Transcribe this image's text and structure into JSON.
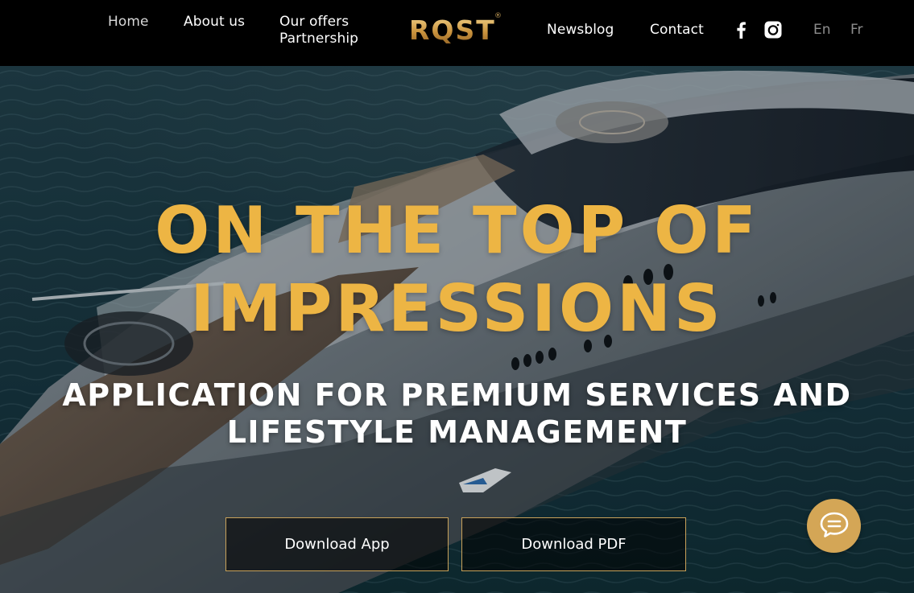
{
  "header": {
    "nav_left": {
      "home": "Home",
      "about": "About us",
      "offers": "Our offers",
      "partnership": "Partnership"
    },
    "logo": "RQST",
    "logo_mark": "®",
    "nav_right": {
      "newsblog": "Newsblog",
      "contact": "Contact"
    },
    "social_icons": [
      "facebook-icon",
      "instagram-icon"
    ],
    "languages": [
      "En",
      "Fr"
    ]
  },
  "hero": {
    "headline_line1": "ON THE TOP OF",
    "headline_line2": "IMPRESSIONS",
    "subheadline_line1": "APPLICATION FOR PREMIUM SERVICES AND",
    "subheadline_line2": "LIFESTYLE MANAGEMENT",
    "buttons": {
      "download_app": "Download App",
      "download_pdf": "Download PDF"
    },
    "chat_icon": "chat-bubble-icon"
  },
  "colors": {
    "accent_gold": "#edb544",
    "chat_gold": "#d4a656",
    "button_border": "#c9a25a",
    "header_bg": "#000000",
    "language_inactive": "#8d8d8d"
  }
}
